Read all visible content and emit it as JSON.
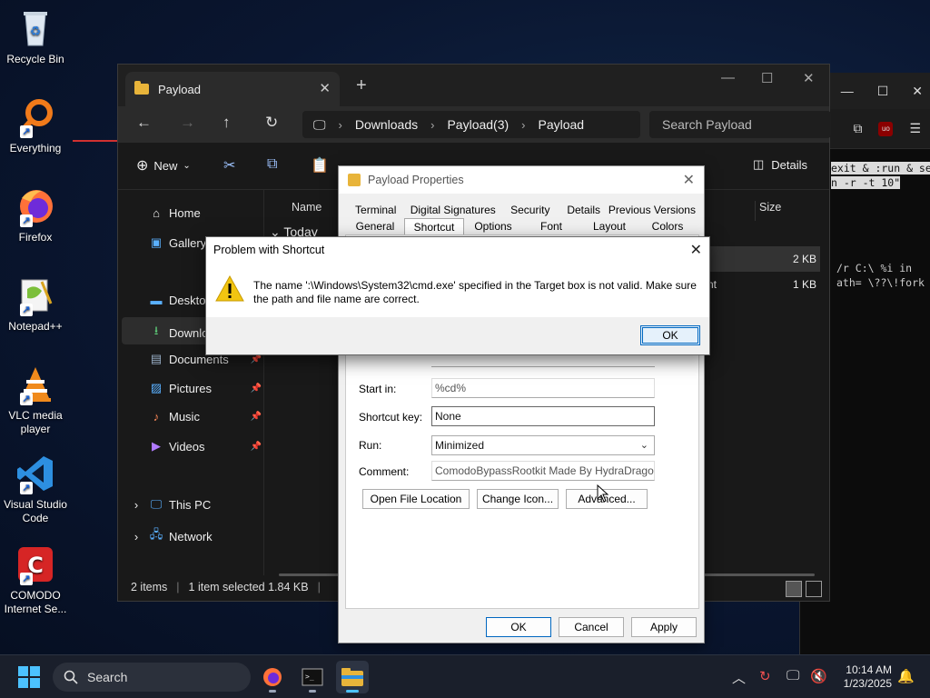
{
  "desktop": {
    "icons": [
      {
        "label": "Recycle Bin",
        "icon": "recycle-bin-icon"
      },
      {
        "label": "Everything",
        "icon": "everything-search-icon"
      },
      {
        "label": "Firefox",
        "icon": "firefox-icon"
      },
      {
        "label": "Notepad++",
        "icon": "notepadpp-icon"
      },
      {
        "label": "VLC media player",
        "icon": "vlc-icon"
      },
      {
        "label": "Visual Studio Code",
        "icon": "vscode-icon"
      },
      {
        "label": "COMODO Internet Se...",
        "icon": "comodo-icon"
      }
    ]
  },
  "terminal": {
    "lines": [
      "exit & :run & se",
      "n -r -t 10\"",
      "/r C:\\ %i in",
      "ath= \\??\\!fork"
    ]
  },
  "explorer": {
    "tab_title": "Payload",
    "breadcrumb": [
      "Downloads",
      "Payload(3)",
      "Payload"
    ],
    "search_placeholder": "Search Payload",
    "new_label": "New",
    "details_label": "Details",
    "sidebar": [
      {
        "label": "Home"
      },
      {
        "label": "Gallery"
      },
      {
        "label": "Desktop"
      },
      {
        "label": "Downlo"
      },
      {
        "label": "Documents"
      },
      {
        "label": "Pictures"
      },
      {
        "label": "Music"
      },
      {
        "label": "Videos"
      },
      {
        "label": "This PC"
      },
      {
        "label": "Network"
      }
    ],
    "columns": {
      "name": "Name",
      "size": "Size"
    },
    "group_label": "Today",
    "rows": [
      {
        "type_fragment": "",
        "size": "2 KB"
      },
      {
        "type_fragment": "nt",
        "size": "1 KB"
      }
    ],
    "status": {
      "items": "2 items",
      "selected": "1 item selected  1.84 KB"
    }
  },
  "properties": {
    "title": "Payload Properties",
    "tabs_row1": [
      "Terminal",
      "Digital Signatures",
      "Security",
      "Details",
      "Previous Versions"
    ],
    "tabs_row2": [
      "General",
      "Shortcut",
      "Options",
      "Font",
      "Layout",
      "Colors"
    ],
    "active_tab": "Shortcut",
    "start_in_label": "Start in:",
    "start_in_value": "%cd%",
    "shortcut_key_label": "Shortcut key:",
    "shortcut_key_value": "None",
    "run_label": "Run:",
    "run_value": "Minimized",
    "comment_label": "Comment:",
    "comment_value": "ComodoBypassRootkit Made By HydraDragonAnt",
    "btn_open_location": "Open File Location",
    "btn_change_icon": "Change Icon...",
    "btn_advanced": "Advanced...",
    "btn_ok": "OK",
    "btn_cancel": "Cancel",
    "btn_apply": "Apply"
  },
  "error_dialog": {
    "title": "Problem with Shortcut",
    "message": "The name ':\\Windows\\System32\\cmd.exe' specified in the Target box is not valid. Make sure the path and file name are correct.",
    "ok_label": "OK"
  },
  "taskbar": {
    "search_label": "Search",
    "time": "10:14 AM",
    "date": "1/23/2025"
  },
  "colors": {
    "accent": "#0067c0",
    "taskbar_accent": "#4cc2ff",
    "folder": "#e8b43a"
  }
}
